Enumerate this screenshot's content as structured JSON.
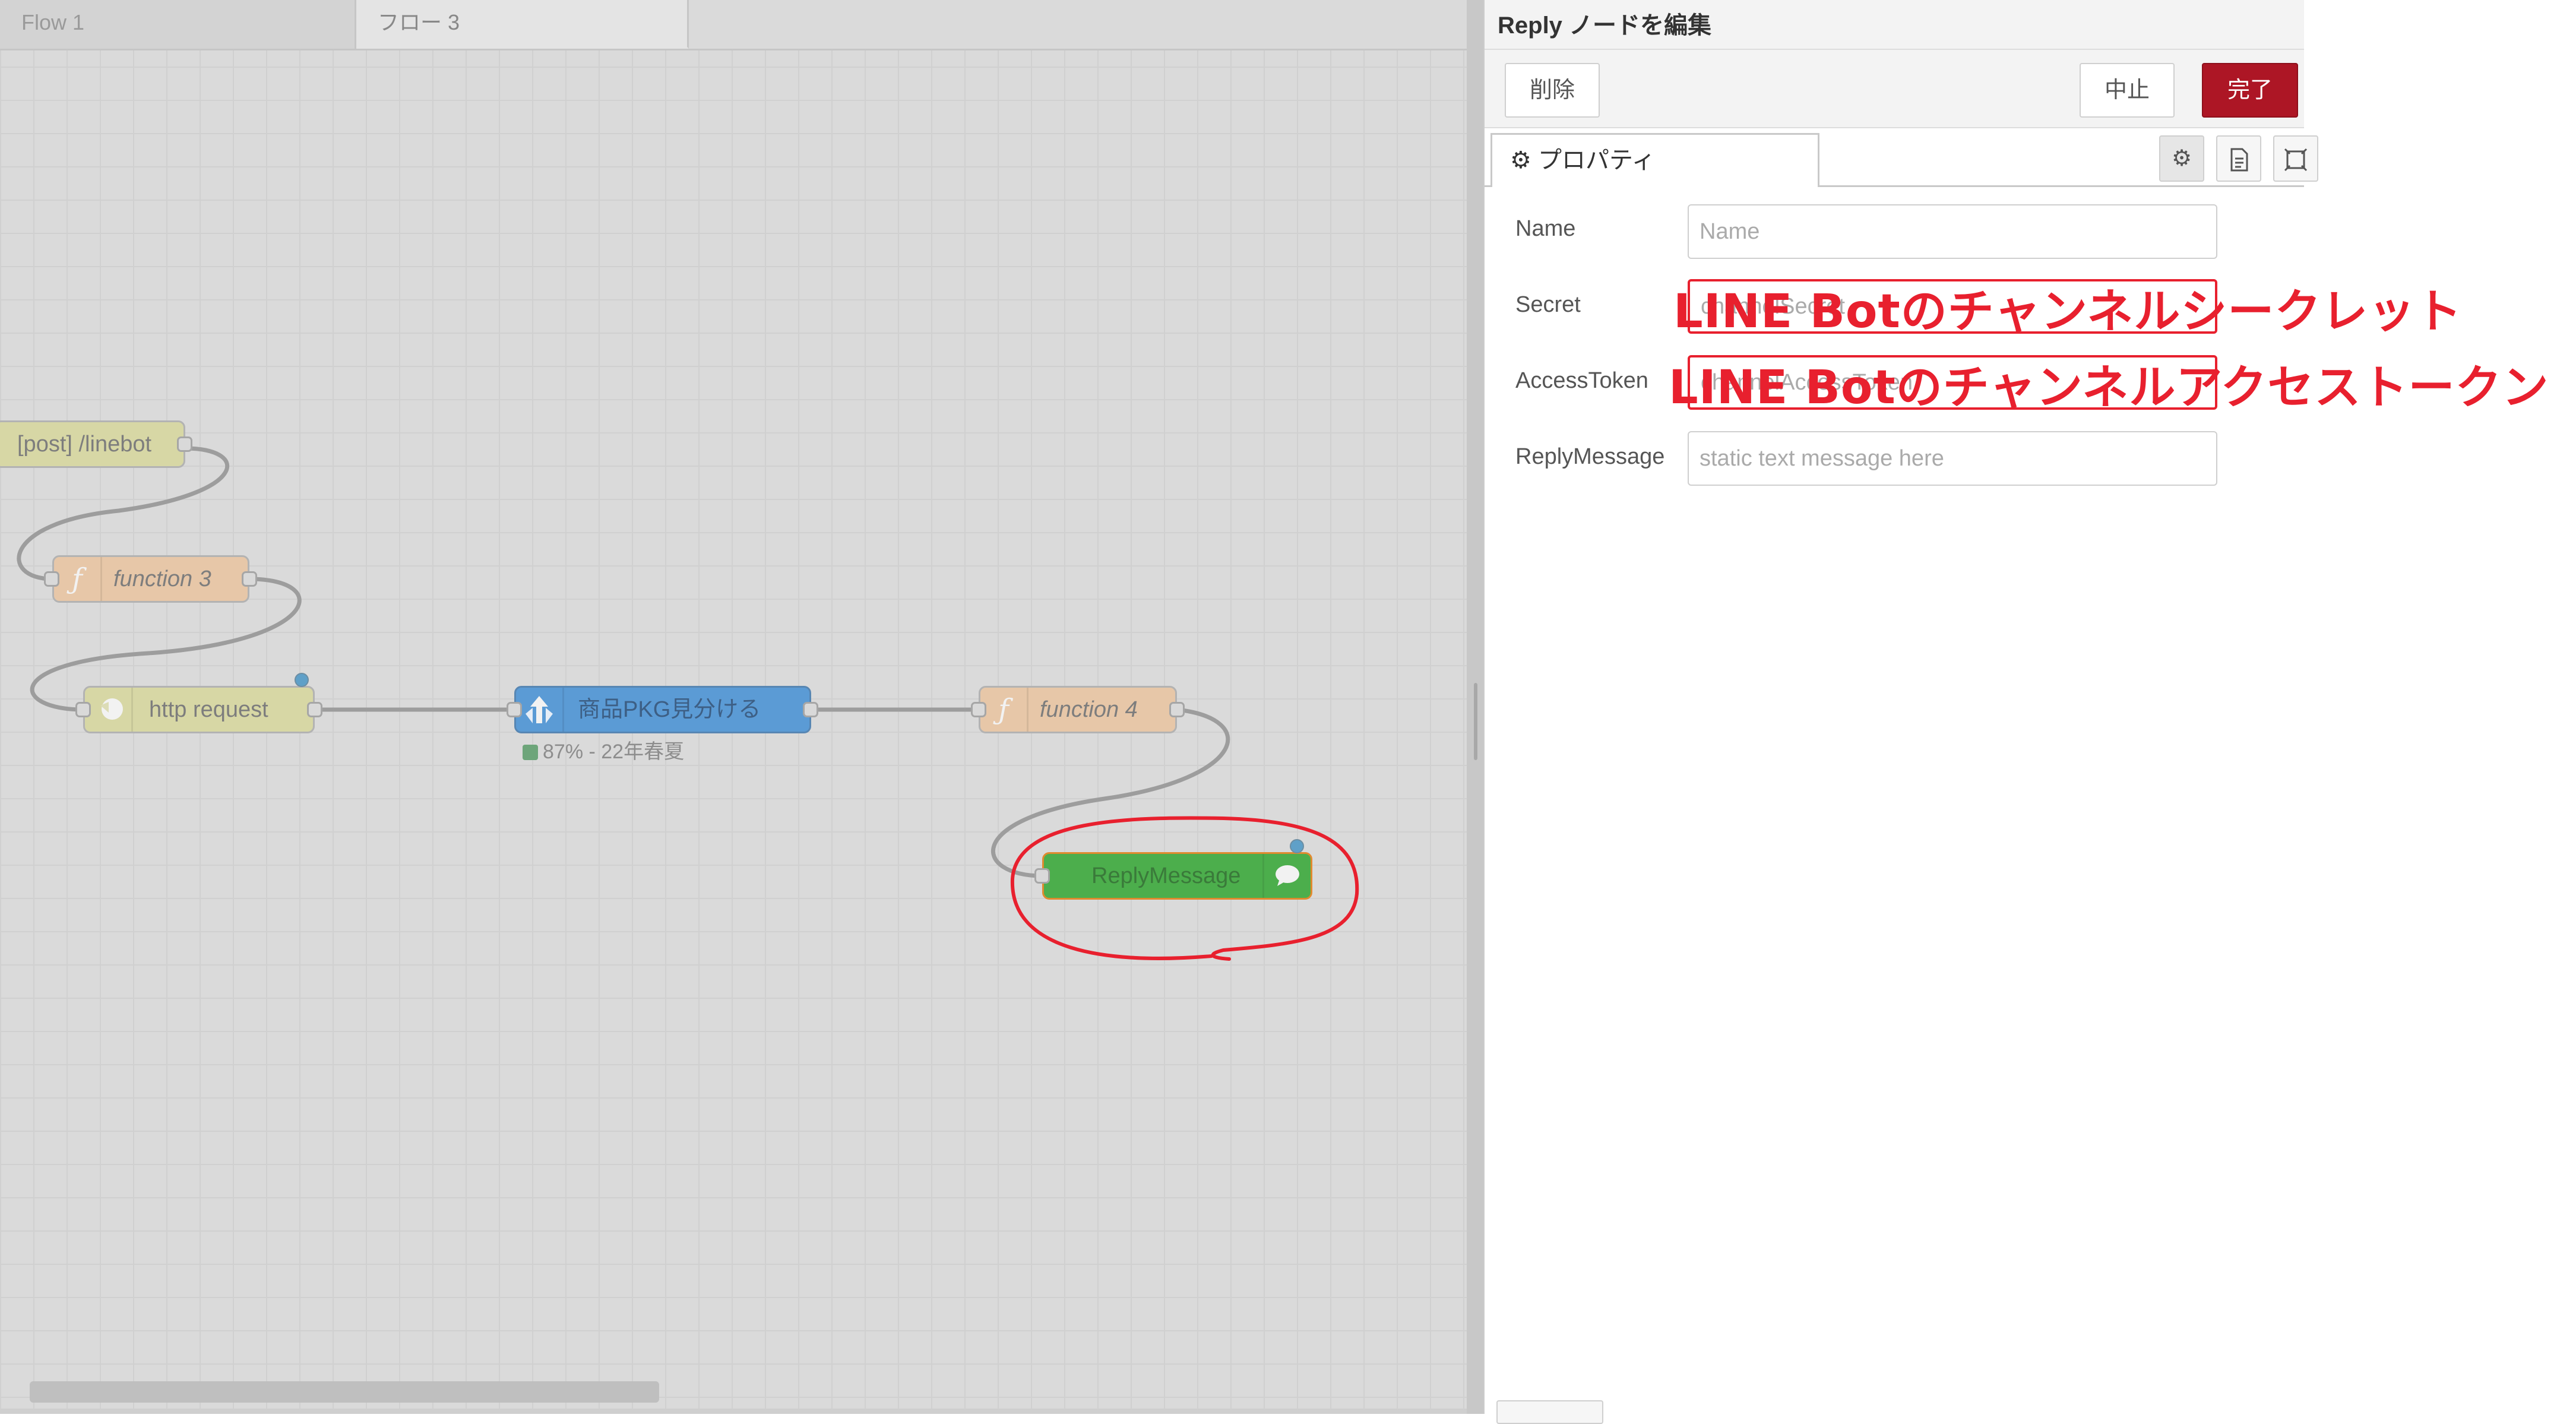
{
  "workspace": {
    "tabs": [
      {
        "label": "Flow 1"
      },
      {
        "label": "フロー 3"
      }
    ],
    "nodes": {
      "linebot_in": {
        "label": "[post] /linebot"
      },
      "function3": {
        "label": "function 3",
        "icon": "function-icon"
      },
      "http_request": {
        "label": "http request",
        "icon": "globe-icon"
      },
      "classifier": {
        "label": "商品PKG見分ける",
        "icon": "tree-icon"
      },
      "function4": {
        "label": "function 4",
        "icon": "function-icon"
      },
      "reply": {
        "label": "ReplyMessage",
        "icon": "speech-bubble-icon"
      }
    },
    "classifier_status": "87% - 22年春夏",
    "colors": {
      "http_in": "#d7d7a5",
      "function": "#e7c7a8",
      "http_request": "#d7d7a5",
      "classifier": "#5b9bd5",
      "reply": "#4cae4c",
      "annotation": "#e8202e"
    }
  },
  "editor": {
    "title": "Reply ノードを編集",
    "buttons": {
      "delete": "削除",
      "cancel": "中止",
      "done": "完了"
    },
    "tab_label": "プロパティ",
    "fields": {
      "name": {
        "label": "Name",
        "placeholder": "Name"
      },
      "secret": {
        "label": "Secret",
        "placeholder": "channelSecret"
      },
      "access_token": {
        "label": "AccessToken",
        "placeholder": "channelAccessToken"
      },
      "reply_message": {
        "label": "ReplyMessage",
        "placeholder": "static text message here"
      }
    }
  },
  "annotations": {
    "secret_note": "LINE Botのチャンネルシークレット",
    "token_note": "LINE Botのチャンネルアクセストークン"
  }
}
